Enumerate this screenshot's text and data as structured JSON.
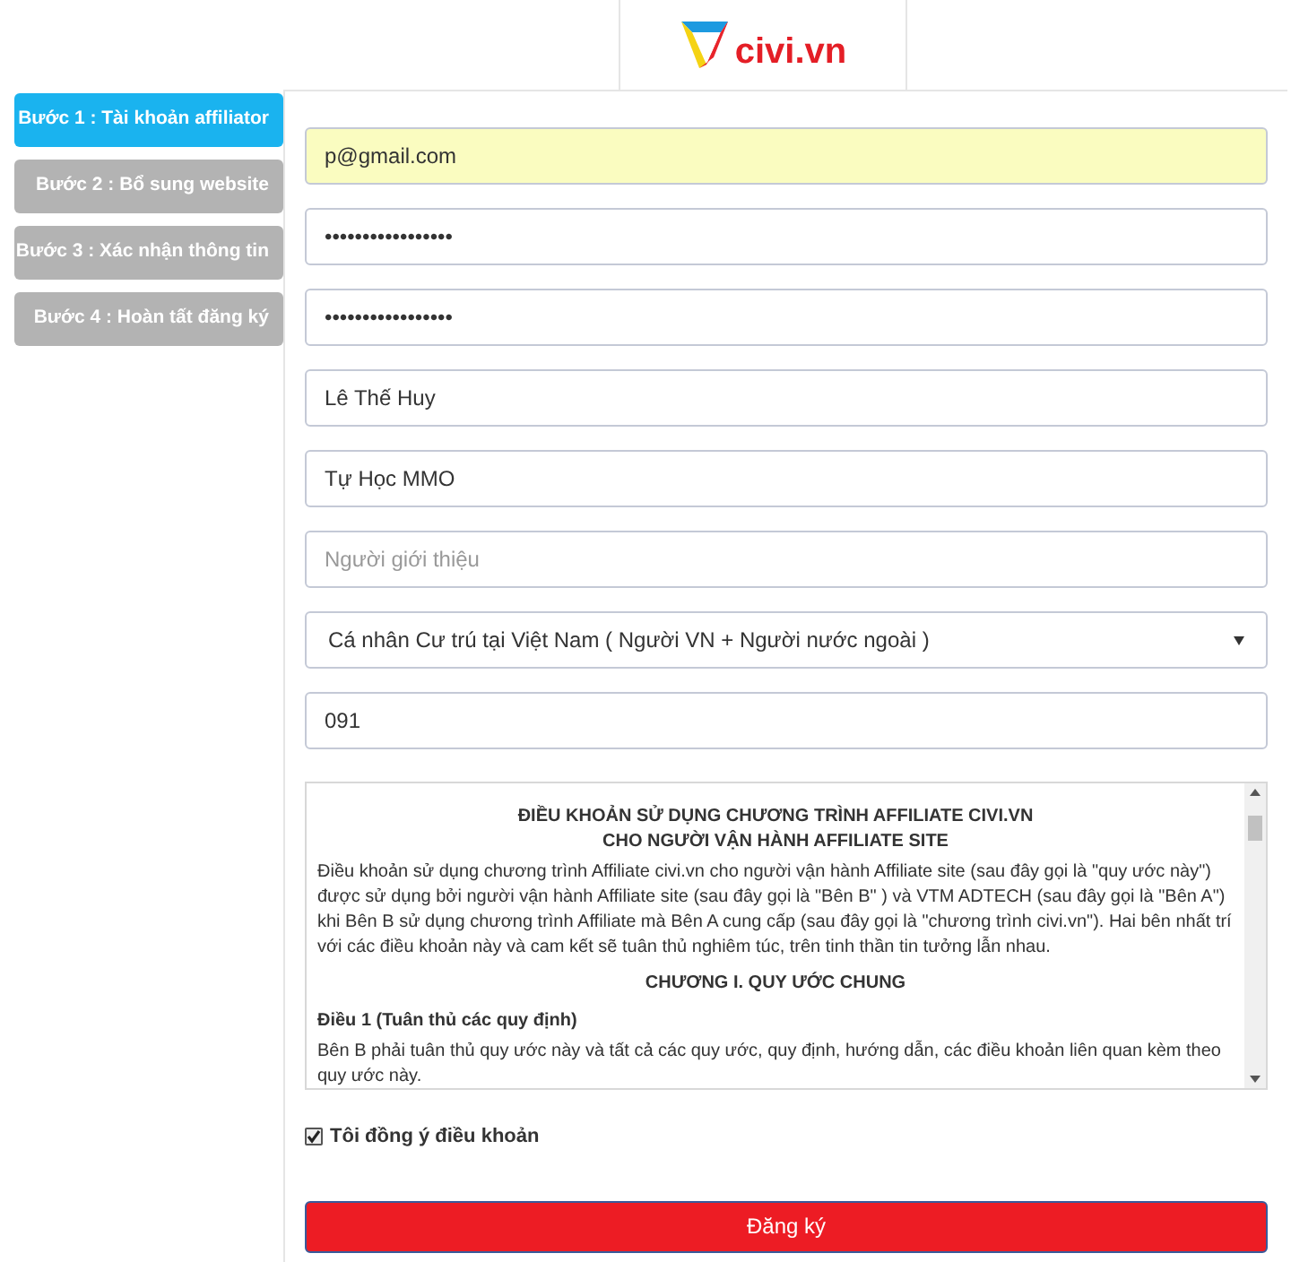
{
  "logo": {
    "text": "civi.vn"
  },
  "steps": [
    {
      "label": "Bước 1 : Tài khoản affiliator",
      "selected": true
    },
    {
      "label": "Bước 2 : Bổ sung website",
      "selected": false
    },
    {
      "label": "Bước 3 : Xác nhận thông tin",
      "selected": false
    },
    {
      "label": "Bước 4 : Hoàn tất đăng ký",
      "selected": false
    }
  ],
  "fields": [
    {
      "kind": "text",
      "value": "p@gmail.com",
      "autofilled": true
    },
    {
      "kind": "text",
      "value": "•••••••••••••••••",
      "autofilled": false
    },
    {
      "kind": "text",
      "value": "•••••••••••••••••",
      "autofilled": false
    },
    {
      "kind": "text",
      "value": "Lê Thế Huy",
      "autofilled": false
    },
    {
      "kind": "text",
      "value": "Tự Học MMO",
      "autofilled": false
    },
    {
      "kind": "text",
      "placeholder": "Người giới thiệu",
      "autofilled": false
    },
    {
      "kind": "select",
      "value": "Cá nhân Cư trú tại Việt Nam ( Người VN + Người nước ngoài )",
      "autofilled": false
    },
    {
      "kind": "text",
      "value": "091",
      "autofilled": false
    }
  ],
  "terms": {
    "title_lines": [
      "ĐIỀU KHOẢN SỬ DỤNG CHƯƠNG TRÌNH AFFILIATE CIVI.VN",
      "CHO NGƯỜI VẬN HÀNH AFFILIATE SITE"
    ],
    "blocks": [
      {
        "kind": "paragraph",
        "text": "Điều khoản sử dụng chương trình Affiliate civi.vn cho người vận hành Affiliate site (sau đây gọi là \"quy ước này\") được sử dụng bởi người vận hành Affiliate site (sau đây gọi là \"Bên B\" ) và VTM ADTECH (sau đây gọi là \"Bên A\") khi Bên B sử dụng chương trình Affiliate mà Bên A cung cấp (sau đây gọi là \"chương trình civi.vn\"). Hai bên nhất trí với các điều khoản này và cam kết sẽ tuân thủ nghiêm túc, trên tinh thần tin tưởng lẫn nhau."
      },
      {
        "kind": "heading",
        "text": "CHƯƠNG I. QUY ƯỚC CHUNG"
      },
      {
        "kind": "article",
        "text": "Điều 1 (Tuân thủ các quy định)"
      },
      {
        "kind": "paragraph",
        "text": "Bên B phải tuân thủ quy ước này và tất cả các quy ước, quy định, hướng dẫn, các điều khoản liên quan kèm theo quy ước này."
      }
    ]
  },
  "agree": {
    "label": "Tôi đồng ý điều khoản",
    "checked": true
  },
  "submit": {
    "label": "Đăng ký"
  }
}
